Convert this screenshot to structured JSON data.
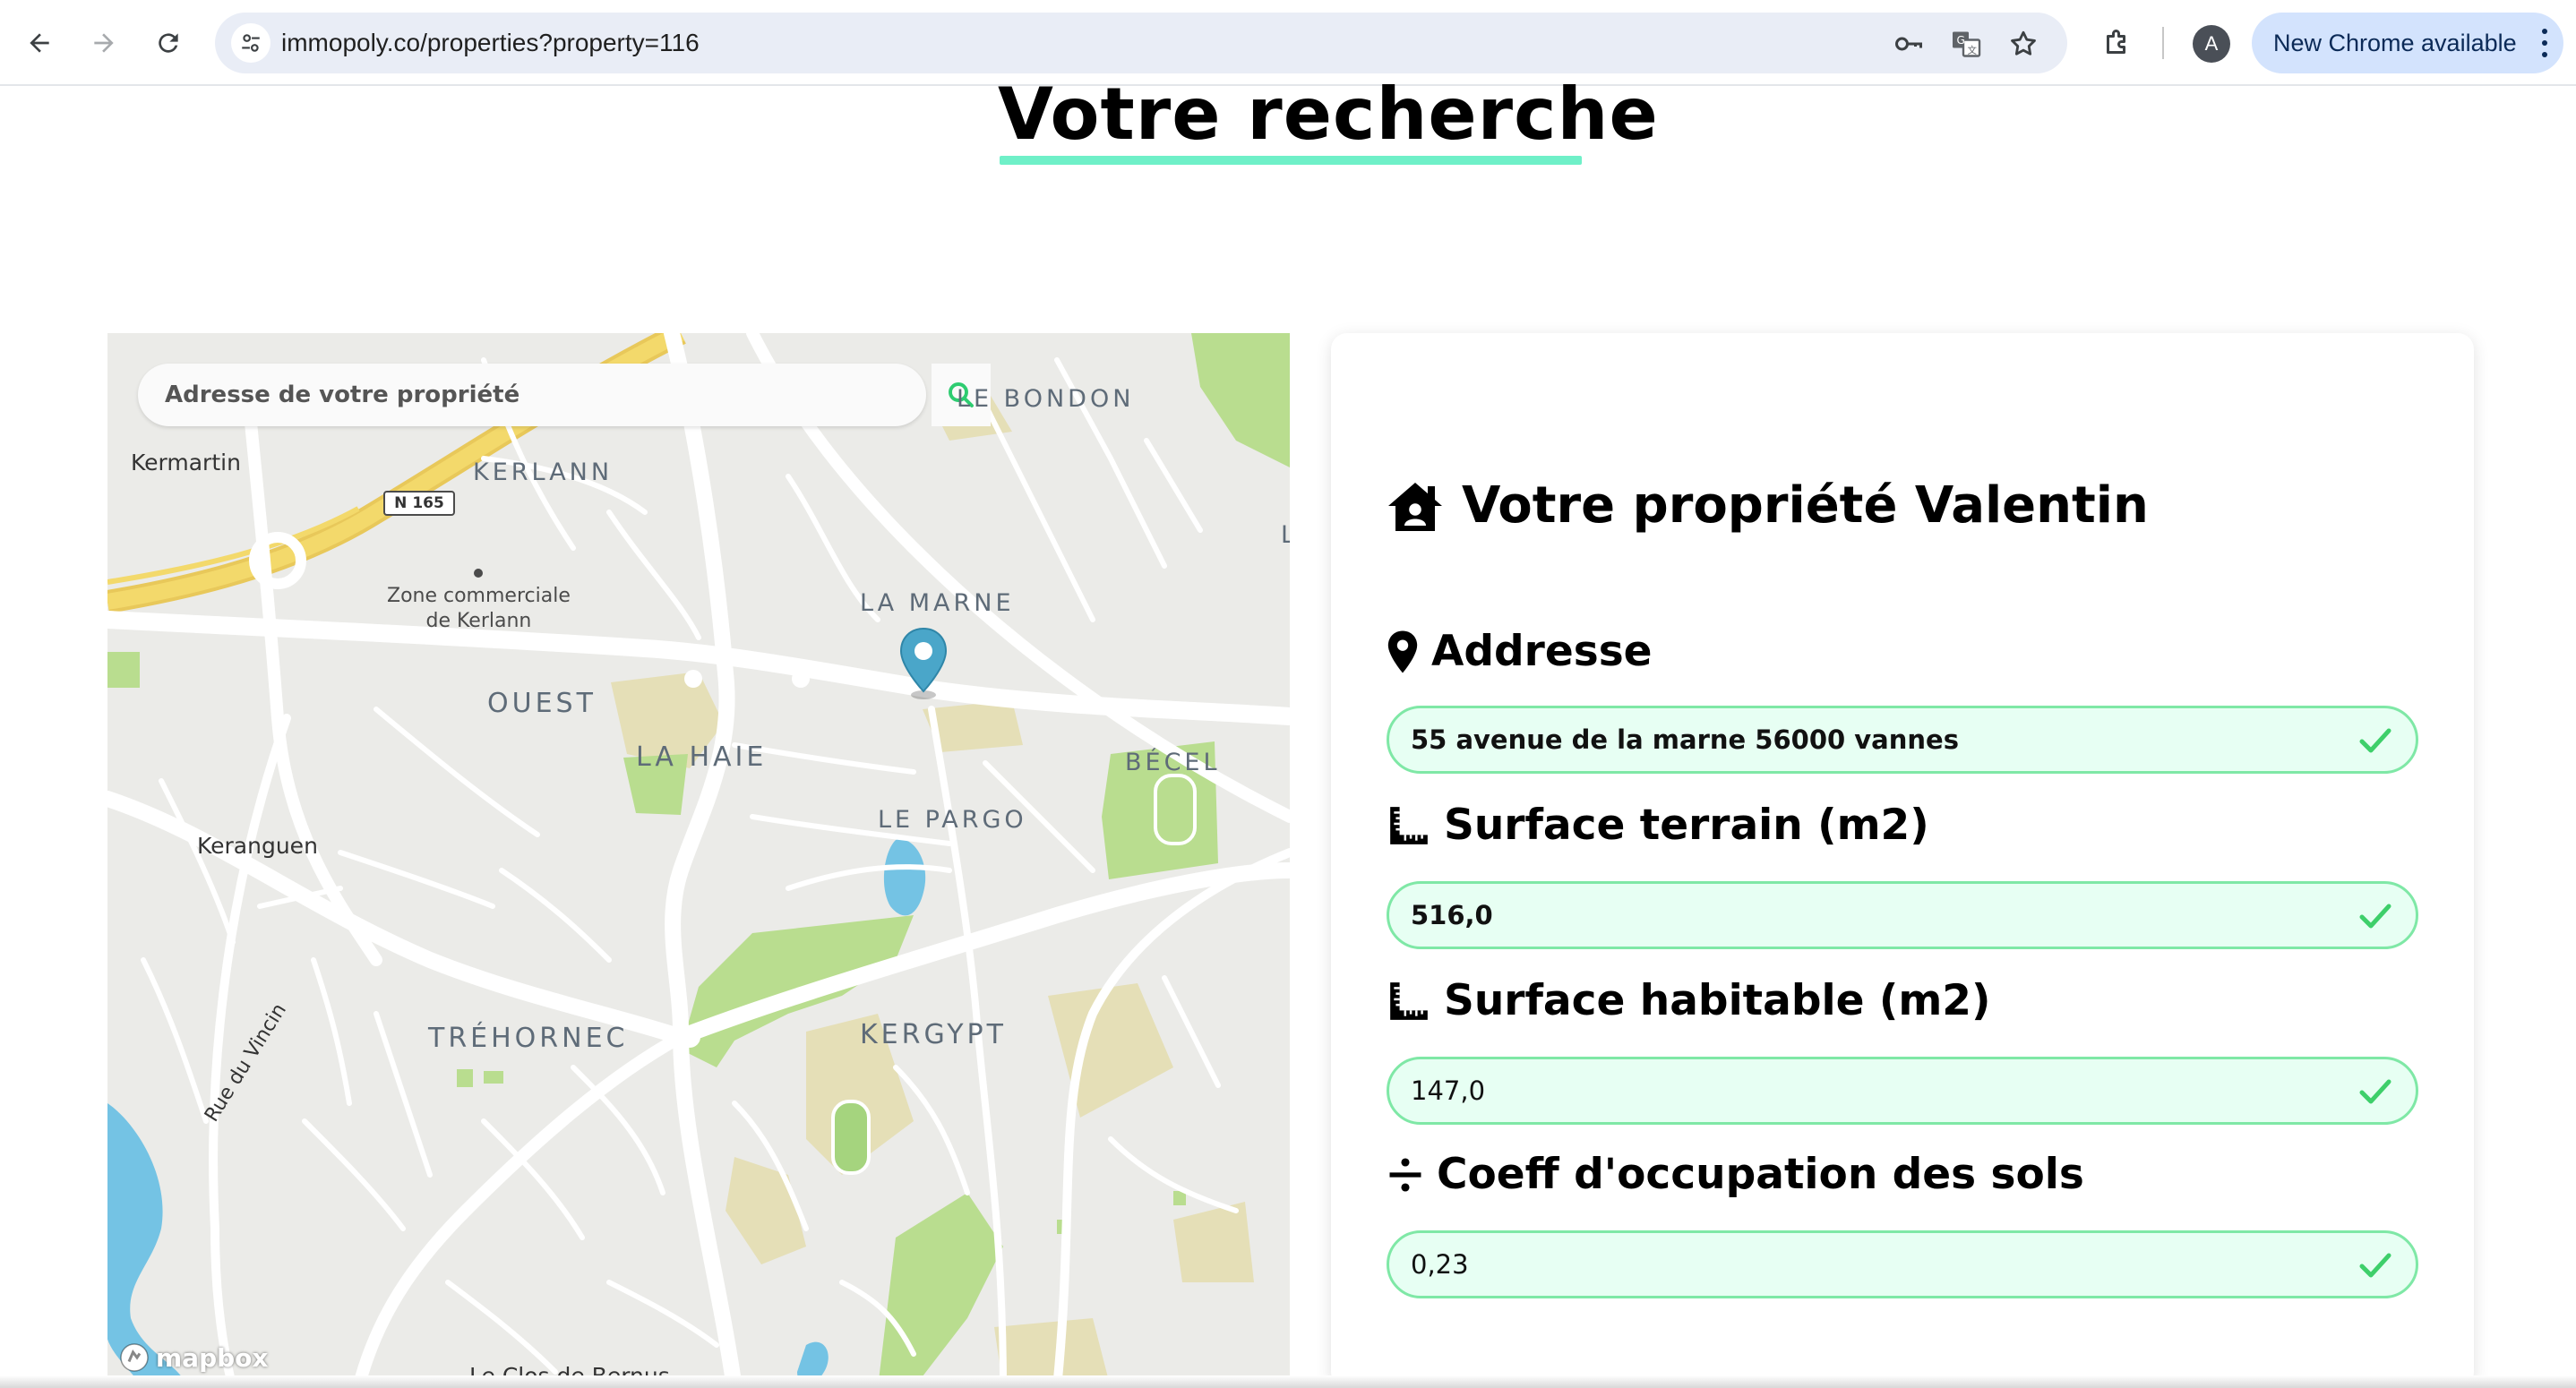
{
  "browser": {
    "url": "immopoly.co/properties?property=116",
    "profile_initial": "A",
    "update_label": "New Chrome available"
  },
  "page": {
    "title": "Votre recherche"
  },
  "map": {
    "search_placeholder": "Adresse de votre propriété",
    "road_shield": "N 165",
    "labels": {
      "le_bondon": "LE BONDON",
      "kermartin": "Kermartin",
      "kerlann": "KERLANN",
      "zone_commerciale_line1": "Zone commerciale",
      "zone_commerciale_line2": "de Kerlann",
      "la_marne": "LA MARNE",
      "ouest": "OUEST",
      "la_haie": "LA HAIE",
      "becel": "BÉCEL",
      "le_pargo": "LE PARGO",
      "keranguen": "Keranguen",
      "trehornec": "TRÉHORNEC",
      "kergypt": "KERGYPT",
      "rue_du_vincin": "Rue du Vincin",
      "le_clos_de_bernus": "Le Clos de Bernus",
      "edge_letter": "L"
    },
    "attribution": "mapbox",
    "colors": {
      "land": "#ebebe8",
      "road": "#ffffff",
      "highway": "#f3d96b",
      "park": "#b9dd8f",
      "landuse": "#e5dfb7",
      "water": "#74c3e4",
      "pin": "#4aa6c9"
    }
  },
  "property": {
    "title": "Votre propriété Valentin",
    "fields": [
      {
        "label": "Addresse",
        "value": "55 avenue de la marne 56000 vannes",
        "icon": "location-pin-icon"
      },
      {
        "label": "Surface terrain (m2)",
        "value": "516,0",
        "icon": "ruler-icon"
      },
      {
        "label": "Surface habitable (m2)",
        "value": "147,0",
        "icon": "ruler-icon"
      },
      {
        "label": "Coeff d'occupation des sols",
        "value": "0,23",
        "icon": "divide-icon"
      }
    ],
    "colors": {
      "field_bg": "#e7fff3",
      "field_border": "#7fe8a6",
      "check": "#3ecf6a",
      "title_underline": "#6ff0c8"
    }
  }
}
